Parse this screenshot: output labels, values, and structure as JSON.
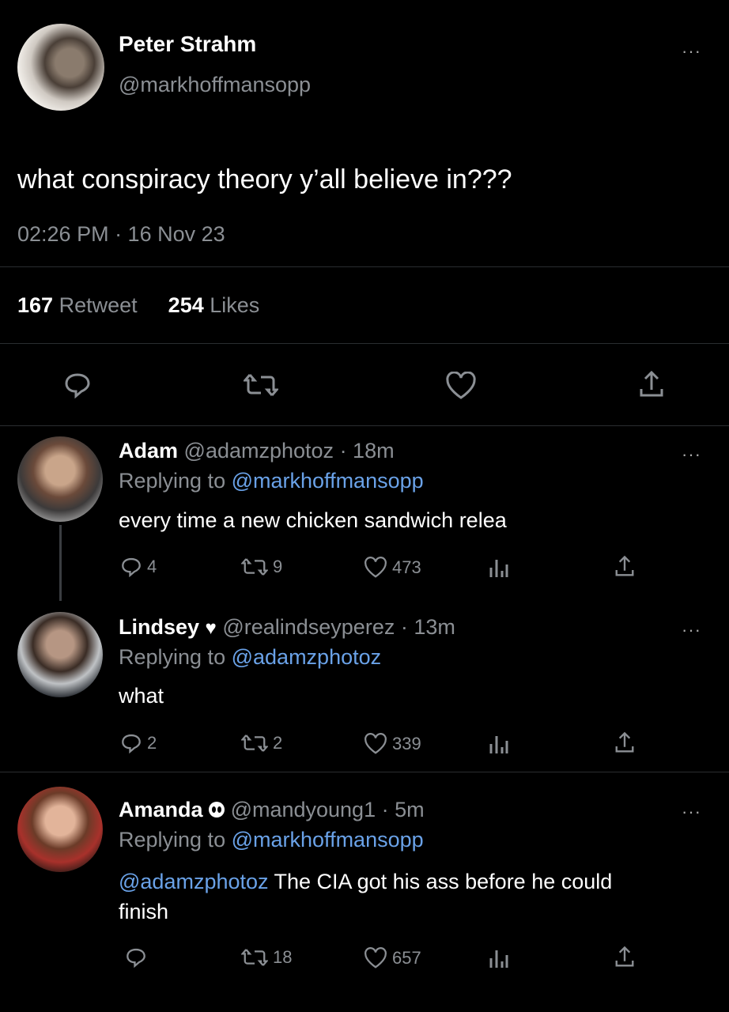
{
  "colors": {
    "background": "#000000",
    "text": "#e7e9ea",
    "muted": "#8b8f94",
    "link": "#6aa2e8",
    "divider": "#2a2d30"
  },
  "main_tweet": {
    "display_name": "Peter Strahm",
    "handle": "@markhoffmansopp",
    "text": "what conspiracy theory y’all believe in???",
    "timestamp": "02:26 PM · 16 Nov 23",
    "retweet_count": "167",
    "retweet_label": "Retweet",
    "likes_count": "254",
    "likes_label": "Likes",
    "more": "···"
  },
  "replies": [
    {
      "display_name": "Adam",
      "handle": "@adamzphotoz",
      "time": "· 18m",
      "replying_prefix": "Replying to",
      "replying_to": "@markhoffmansopp",
      "text": "every time a new chicken sandwich relea",
      "replies": "4",
      "retweets": "9",
      "likes": "473",
      "more": "···"
    },
    {
      "display_name": "Lindsey",
      "handle": "@realindseyperez",
      "time": "· 13m",
      "replying_prefix": "Replying to",
      "replying_to": "@adamzphotoz",
      "text": "what",
      "replies": "2",
      "retweets": "2",
      "likes": "339",
      "more": "···"
    },
    {
      "display_name": "Amanda",
      "handle": "@mandyoung1",
      "time": "· 5m",
      "replying_prefix": "Replying to",
      "replying_to": "@markhoffmansopp",
      "text_mention": "@adamzphotoz",
      "text_line1": " The CIA got his ass before he could",
      "text_line2": "finish",
      "replies": "",
      "retweets": "18",
      "likes": "657",
      "more": "···"
    }
  ]
}
